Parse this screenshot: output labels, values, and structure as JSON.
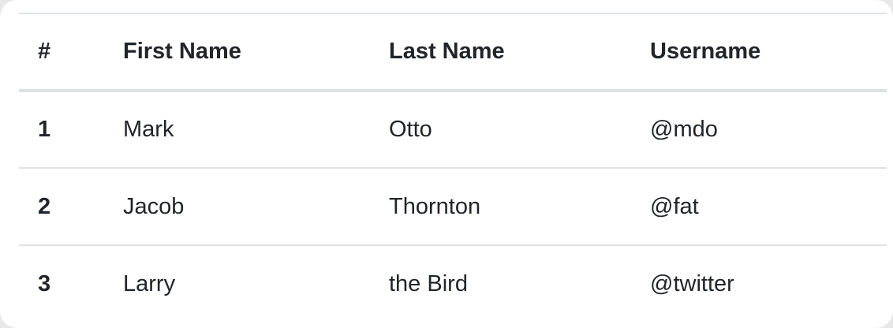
{
  "table": {
    "headers": [
      "#",
      "First Name",
      "Last Name",
      "Username"
    ],
    "rows": [
      {
        "index": "1",
        "first_name": "Mark",
        "last_name": "Otto",
        "username": "@mdo"
      },
      {
        "index": "2",
        "first_name": "Jacob",
        "last_name": "Thornton",
        "username": "@fat"
      },
      {
        "index": "3",
        "first_name": "Larry",
        "last_name": "the Bird",
        "username": "@twitter"
      }
    ]
  }
}
